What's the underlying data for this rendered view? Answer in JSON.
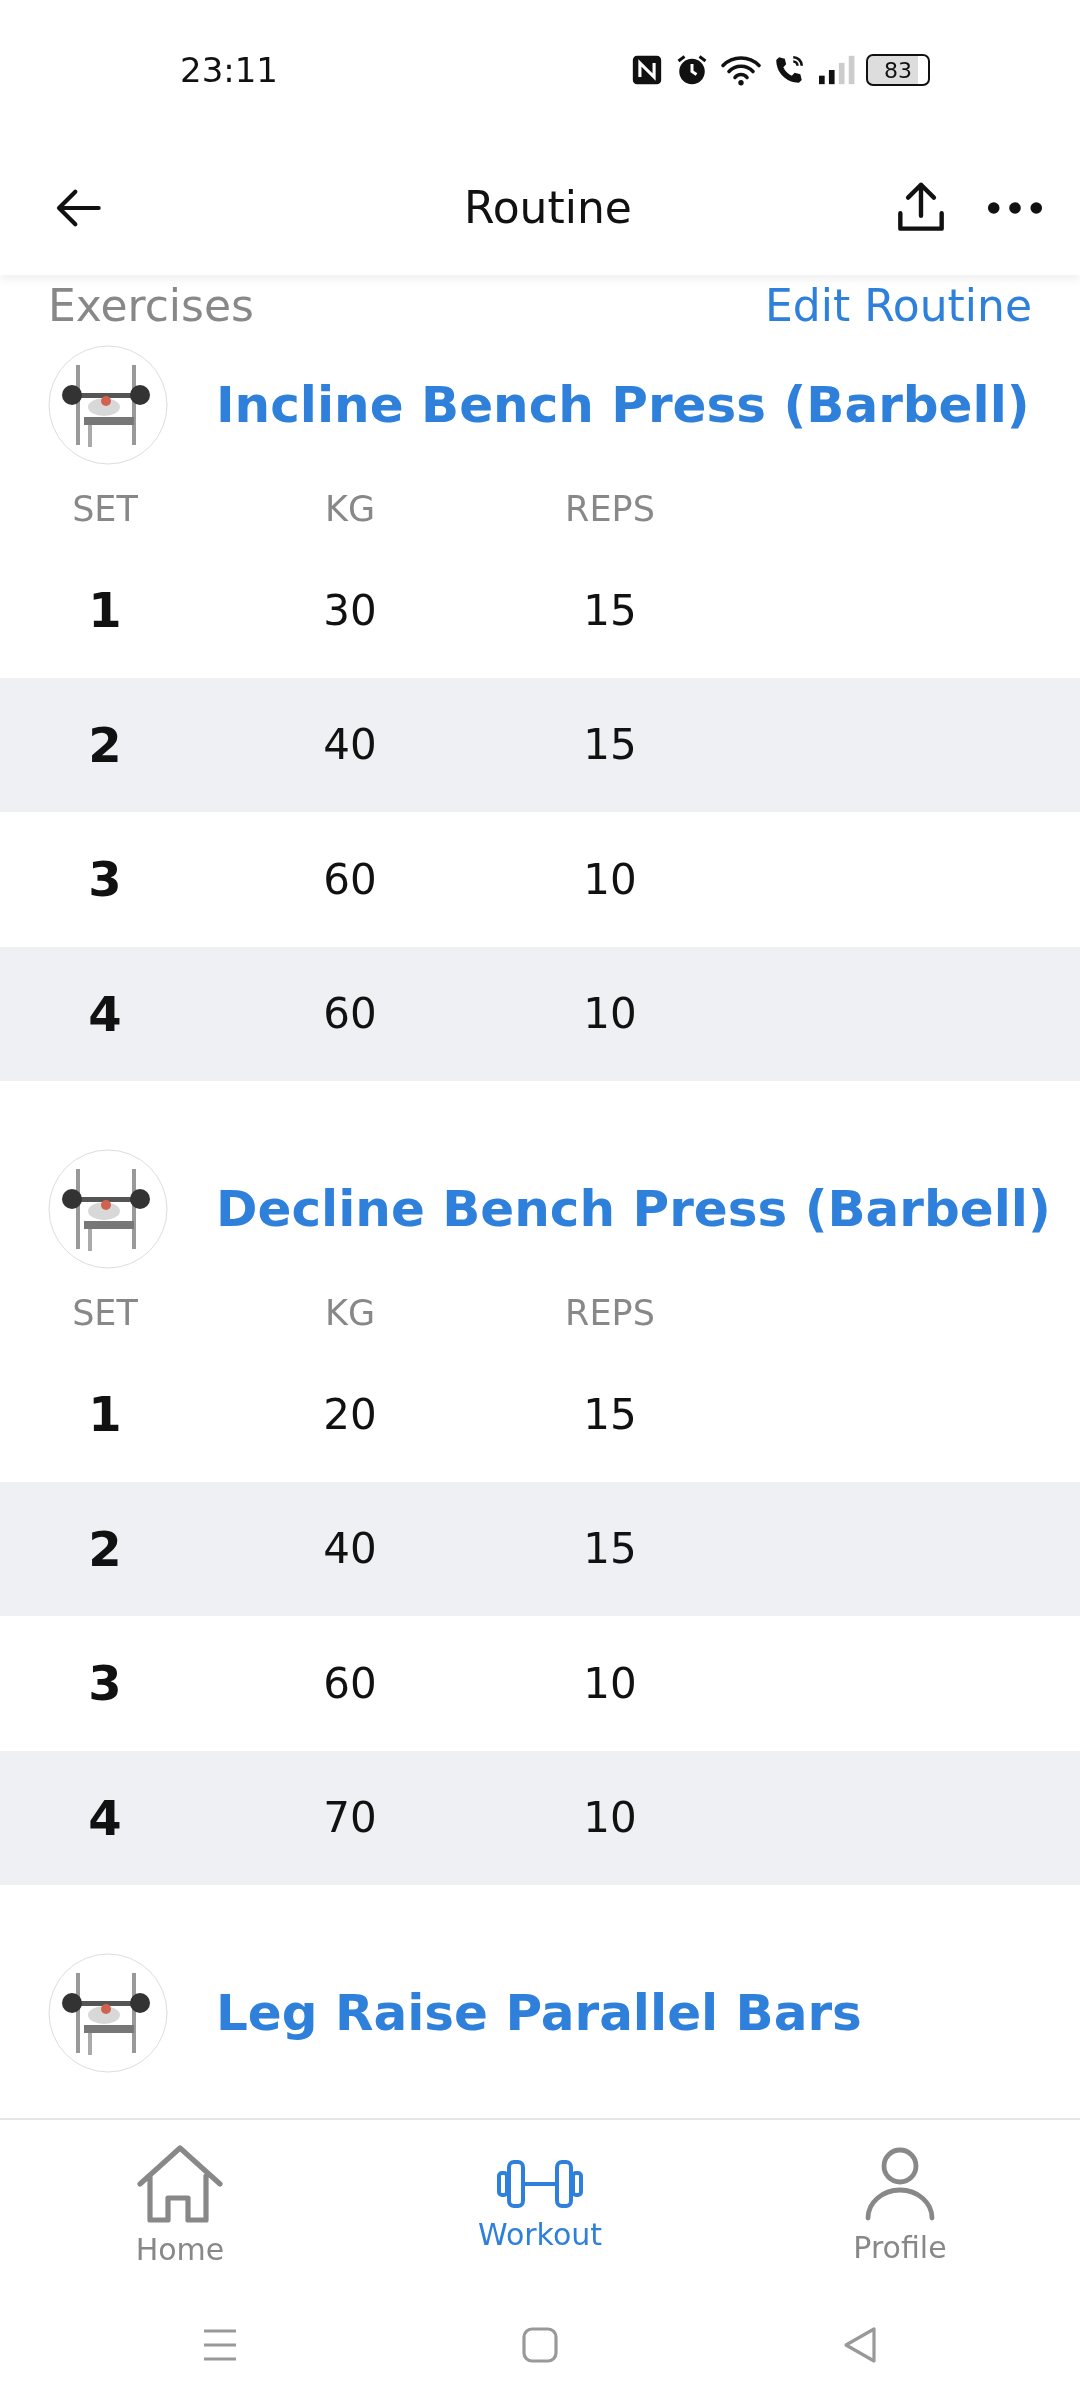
{
  "status_bar": {
    "time": "23:11",
    "battery": "83"
  },
  "header": {
    "title": "Routine"
  },
  "section": {
    "title": "Exercises",
    "action": "Edit Routine"
  },
  "exercises": [
    {
      "name": "Incline Bench Press (Barbell)",
      "columns": [
        "SET",
        "KG",
        "REPS"
      ],
      "sets": [
        {
          "set": "1",
          "kg": "30",
          "reps": "15"
        },
        {
          "set": "2",
          "kg": "40",
          "reps": "15"
        },
        {
          "set": "3",
          "kg": "60",
          "reps": "10"
        },
        {
          "set": "4",
          "kg": "60",
          "reps": "10"
        }
      ]
    },
    {
      "name": "Decline Bench Press (Barbell)",
      "columns": [
        "SET",
        "KG",
        "REPS"
      ],
      "sets": [
        {
          "set": "1",
          "kg": "20",
          "reps": "15"
        },
        {
          "set": "2",
          "kg": "40",
          "reps": "15"
        },
        {
          "set": "3",
          "kg": "60",
          "reps": "10"
        },
        {
          "set": "4",
          "kg": "70",
          "reps": "10"
        }
      ]
    },
    {
      "name": "Leg Raise Parallel Bars"
    }
  ],
  "nav": [
    {
      "kind": "home",
      "label": "Home",
      "selected": false
    },
    {
      "kind": "workout",
      "label": "Workout",
      "selected": true
    },
    {
      "kind": "profile",
      "label": "Profile",
      "selected": false
    }
  ]
}
